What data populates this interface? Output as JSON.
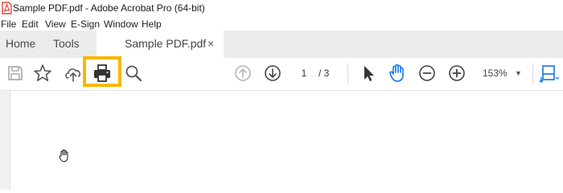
{
  "window": {
    "title": "Sample PDF.pdf - Adobe Acrobat Pro (64-bit)"
  },
  "menu": {
    "items": [
      "File",
      "Edit",
      "View",
      "E-Sign",
      "Window",
      "Help"
    ]
  },
  "tabs": {
    "home": "Home",
    "tools": "Tools",
    "document": "Sample PDF.pdf",
    "close": "×"
  },
  "toolbar": {
    "page_current": "1",
    "page_total": "/ 3",
    "zoom": "153%",
    "zoom_caret": "▼",
    "icons": [
      "save-icon",
      "star-icon",
      "cloud-upload-icon",
      "print-icon",
      "search-zoom-icon",
      "arrow-up-icon",
      "arrow-down-icon",
      "pointer-icon",
      "hand-icon",
      "zoom-out-icon",
      "zoom-in-icon",
      "page-fit-icon"
    ]
  },
  "colors": {
    "highlight": "#f5b800",
    "accent": "#1473e6",
    "acrobat_red": "#e0261b"
  }
}
